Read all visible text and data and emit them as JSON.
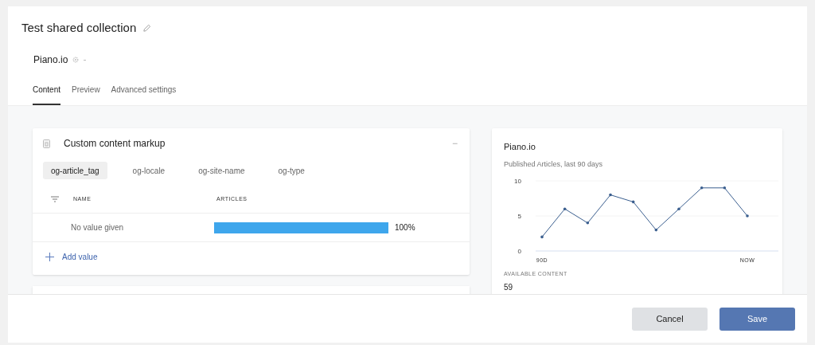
{
  "title": "Test shared collection",
  "site": {
    "name": "Piano.io"
  },
  "tabs": [
    {
      "label": "Content",
      "selected": true
    },
    {
      "label": "Preview",
      "selected": false
    },
    {
      "label": "Advanced settings",
      "selected": false
    }
  ],
  "markup_card": {
    "title": "Custom content markup",
    "collapse": "−",
    "tags": [
      {
        "label": "og-article_tag",
        "selected": true
      },
      {
        "label": "og-locale",
        "selected": false
      },
      {
        "label": "og-site-name",
        "selected": false
      },
      {
        "label": "og-type",
        "selected": false
      }
    ],
    "columns": [
      "NAME",
      "ARTICLES"
    ],
    "rows": [
      {
        "name": "No value given",
        "reading": "100%"
      }
    ],
    "add_label": "Add value"
  },
  "stats_card": {
    "title": "Piano.io",
    "subtitle": "Published Articles, last 90 days",
    "chart_data": {
      "type": "line",
      "categories": [
        "90D",
        null,
        null,
        null,
        null,
        null,
        null,
        null,
        null,
        "NOW"
      ],
      "values": [
        2,
        6,
        4,
        8,
        7,
        3,
        6,
        9,
        9,
        5
      ],
      "ylim": [
        0,
        10
      ],
      "yticks": [
        0,
        5,
        10
      ]
    },
    "available_label": "AVAILABLE CONTENT",
    "available_value": "59"
  },
  "buttons": [
    {
      "kind": "secondary",
      "label": "Cancel"
    },
    {
      "kind": "primary",
      "label": "Save"
    }
  ]
}
